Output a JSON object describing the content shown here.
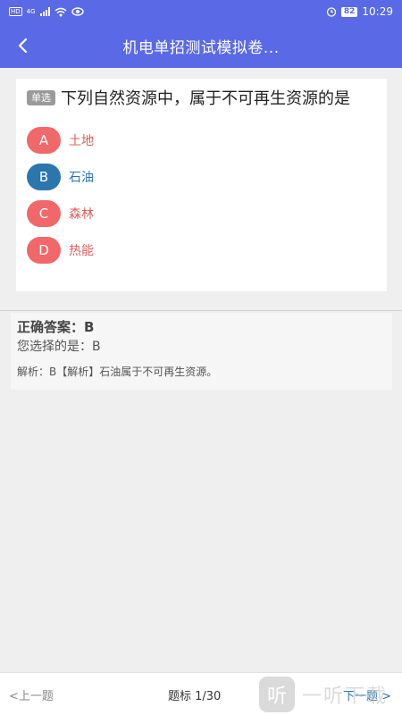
{
  "status_bar": {
    "network": "4G",
    "hd_label": "HD",
    "battery": "82",
    "time": "10:29"
  },
  "header": {
    "title": "机电单招测试模拟卷..."
  },
  "question": {
    "type_tag": "单选",
    "text": "下列自然资源中，属于不可再生资源的是",
    "options": [
      {
        "letter": "A",
        "text": "土地"
      },
      {
        "letter": "B",
        "text": "石油"
      },
      {
        "letter": "C",
        "text": "森林"
      },
      {
        "letter": "D",
        "text": "热能"
      }
    ]
  },
  "answer": {
    "correct": "正确答案：B",
    "chosen": "您选择的是：B",
    "analysis": "解析：B【解析】石油属于不可再生资源。"
  },
  "bottom": {
    "prev": "<上一题",
    "page": "题标 1/30",
    "next": "下一题 >"
  },
  "watermark": {
    "logo": "听",
    "text": "一听下载"
  },
  "colors": {
    "header_bg": "#5a6ae6",
    "option_default": "#f0686a",
    "option_correct": "#2a76ad"
  }
}
